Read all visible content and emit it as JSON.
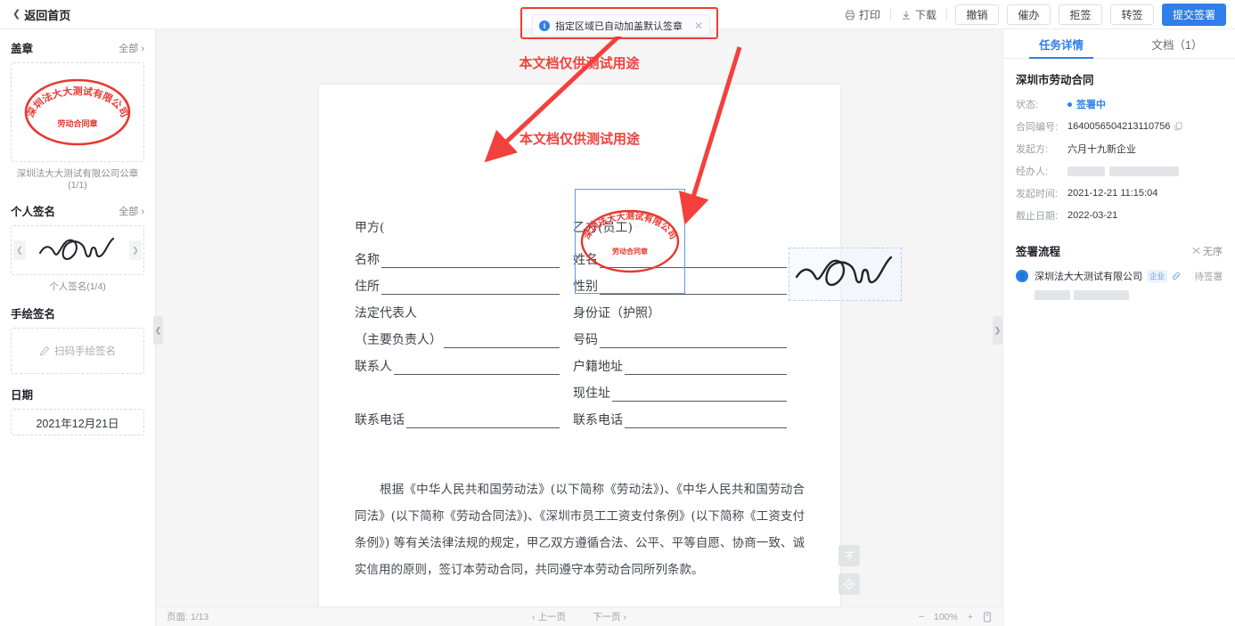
{
  "topbar": {
    "back_label": "返回首页",
    "back_icon": "chevron-left-icon",
    "print_label": "打印",
    "print_icon": "printer-icon",
    "download_label": "下载",
    "download_icon": "download-icon",
    "buttons": [
      {
        "label": "撤销",
        "name": "revoke-button",
        "primary": false
      },
      {
        "label": "催办",
        "name": "urge-button",
        "primary": false
      },
      {
        "label": "拒签",
        "name": "reject-sign-button",
        "primary": false
      },
      {
        "label": "转签",
        "name": "transfer-sign-button",
        "primary": false
      },
      {
        "label": "提交签署",
        "name": "submit-sign-button",
        "primary": true
      }
    ],
    "primary_color": "#2f7eea"
  },
  "banner": {
    "text": "指定区域已自动加盖默认签章",
    "icon": "info-circle-icon",
    "close_icon": "close-icon",
    "highlight_color": "#f23b36"
  },
  "sidebar": {
    "sections": [
      {
        "title": "盖章",
        "all_label": "全部",
        "caption": "深圳法大大测试有限公司公章(1/1)"
      },
      {
        "title": "个人签名",
        "all_label": "全部",
        "caption": "个人签名(1/4)"
      },
      {
        "title": "手绘签名",
        "all_label": "",
        "placeholder": "扫码手绘签名"
      },
      {
        "title": "日期",
        "all_label": "",
        "value": "2021年12月21日"
      }
    ],
    "stamp": {
      "ring_text": "深圳法大大测试有限公司",
      "center_text": "劳动合同章",
      "color": "#e8372f"
    },
    "prev_icon": "chevron-left-icon",
    "next_icon": "chevron-right-icon",
    "pen_icon": "pen-icon"
  },
  "document": {
    "watermark": "本文档仅供测试用途",
    "watermark_color": "#f2413c",
    "party_a_label": "甲方(",
    "party_b_label": "乙方(员工)",
    "left_fields": [
      {
        "label": "名称",
        "line": true
      },
      {
        "label": "住所",
        "line": true
      },
      {
        "label": "法定代表人",
        "line": false
      },
      {
        "label": "（主要负责人）",
        "line": true
      },
      {
        "label": "联系人",
        "line": true
      },
      {
        "label": "",
        "line": false
      },
      {
        "label": "联系电话",
        "line": true
      }
    ],
    "right_fields": [
      {
        "label": "姓名",
        "line": true
      },
      {
        "label": "性别",
        "line": true
      },
      {
        "label": "身份证（护照）",
        "line": false
      },
      {
        "label": "号码",
        "line": true
      },
      {
        "label": "户籍地址",
        "line": true
      },
      {
        "label": "现住址",
        "line": true
      },
      {
        "label": "联系电话",
        "line": true
      }
    ],
    "paragraph": "根据《中华人民共和国劳动法》(以下简称《劳动法》)、《中华人民共和国劳动合同法》(以下简称《劳动合同法》)、《深圳市员工工资支付条例》(以下简称《工资支付条例》) 等有关法律法规的规定，甲乙双方遵循合法、公平、平等自愿、协商一致、诚实信用的原则，签订本劳动合同，共同遵守本劳动合同所列条款。",
    "scroll_top_icon": "scroll-to-top-icon",
    "locate_icon": "target-locate-icon"
  },
  "bottombar": {
    "page_label": "页面: 1/13",
    "prev_page": "上一页",
    "next_page": "下一页",
    "zoom_out": "−",
    "zoom_level": "100%",
    "zoom_in": "+",
    "fit_icon": "fit-page-icon"
  },
  "rightpanel": {
    "tabs": [
      {
        "label": "任务详情",
        "active": true
      },
      {
        "label": "文档（1）",
        "active": false
      }
    ],
    "doc_title": "深圳市劳动合同",
    "details": [
      {
        "key": "状态:",
        "value": "签署中",
        "type": "status"
      },
      {
        "key": "合同编号:",
        "value": "1640056504213110756",
        "type": "copyable"
      },
      {
        "key": "发起方:",
        "value": "六月十九新企业",
        "type": "text"
      },
      {
        "key": "经办人:",
        "value": "",
        "type": "redacted"
      },
      {
        "key": "发起时间:",
        "value": "2021-12-21 11:15:04",
        "type": "text"
      },
      {
        "key": "截止日期:",
        "value": "2022-03-21",
        "type": "text"
      }
    ],
    "flow_title": "签署流程",
    "flow_mode": "无序",
    "flow_mode_icon": "unordered-icon",
    "flow_rows": [
      {
        "name": "深圳法大大测试有限公司",
        "tag": "企业",
        "state": "待签署"
      }
    ],
    "copy_icon": "copy-icon",
    "link_icon": "link-icon",
    "avatar_icon": "user-avatar-icon"
  },
  "handles": {
    "left_icon": "chevron-left-icon",
    "right_icon": "chevron-right-icon"
  }
}
